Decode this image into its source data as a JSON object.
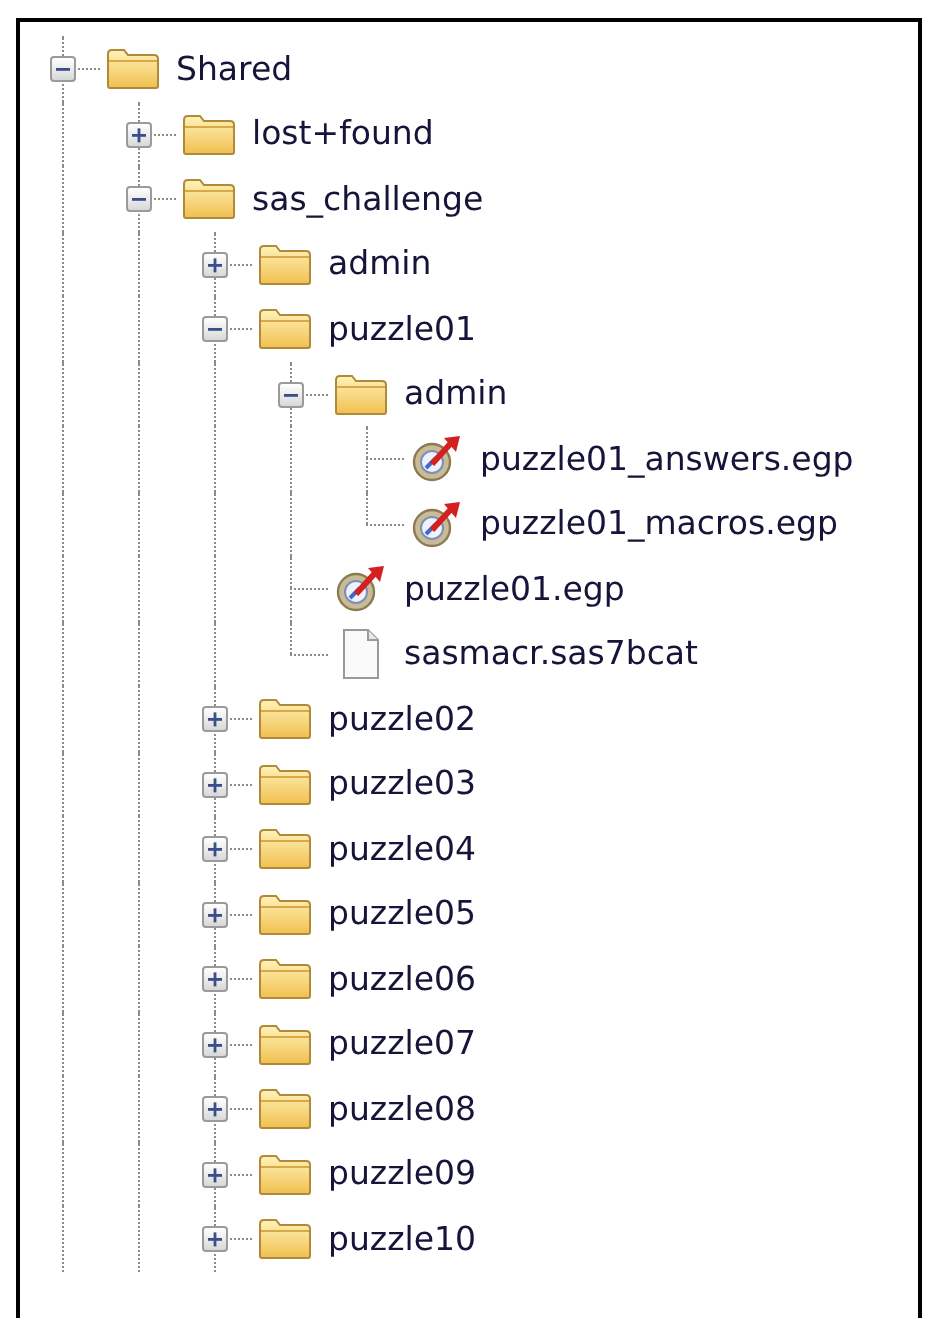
{
  "tree": [
    {
      "kind": "folder",
      "label": "Shared",
      "expanded": true,
      "more_below": true,
      "children": [
        {
          "kind": "folder",
          "label": "lost+found",
          "expanded": false
        },
        {
          "kind": "folder",
          "label": "sas_challenge",
          "expanded": true,
          "more_below": true,
          "children": [
            {
              "kind": "folder",
              "label": "admin",
              "expanded": false
            },
            {
              "kind": "folder",
              "label": "puzzle01",
              "expanded": true,
              "children": [
                {
                  "kind": "folder",
                  "label": "admin",
                  "expanded": true,
                  "children": [
                    {
                      "kind": "egp",
                      "label": "puzzle01_answers.egp"
                    },
                    {
                      "kind": "egp",
                      "label": "puzzle01_macros.egp"
                    }
                  ]
                },
                {
                  "kind": "egp",
                  "label": "puzzle01.egp"
                },
                {
                  "kind": "file",
                  "label": "sasmacr.sas7bcat"
                }
              ]
            },
            {
              "kind": "folder",
              "label": "puzzle02",
              "expanded": false
            },
            {
              "kind": "folder",
              "label": "puzzle03",
              "expanded": false
            },
            {
              "kind": "folder",
              "label": "puzzle04",
              "expanded": false
            },
            {
              "kind": "folder",
              "label": "puzzle05",
              "expanded": false
            },
            {
              "kind": "folder",
              "label": "puzzle06",
              "expanded": false
            },
            {
              "kind": "folder",
              "label": "puzzle07",
              "expanded": false
            },
            {
              "kind": "folder",
              "label": "puzzle08",
              "expanded": false
            },
            {
              "kind": "folder",
              "label": "puzzle09",
              "expanded": false
            },
            {
              "kind": "folder",
              "label": "puzzle10",
              "expanded": false,
              "more_below": true
            }
          ]
        }
      ]
    }
  ]
}
